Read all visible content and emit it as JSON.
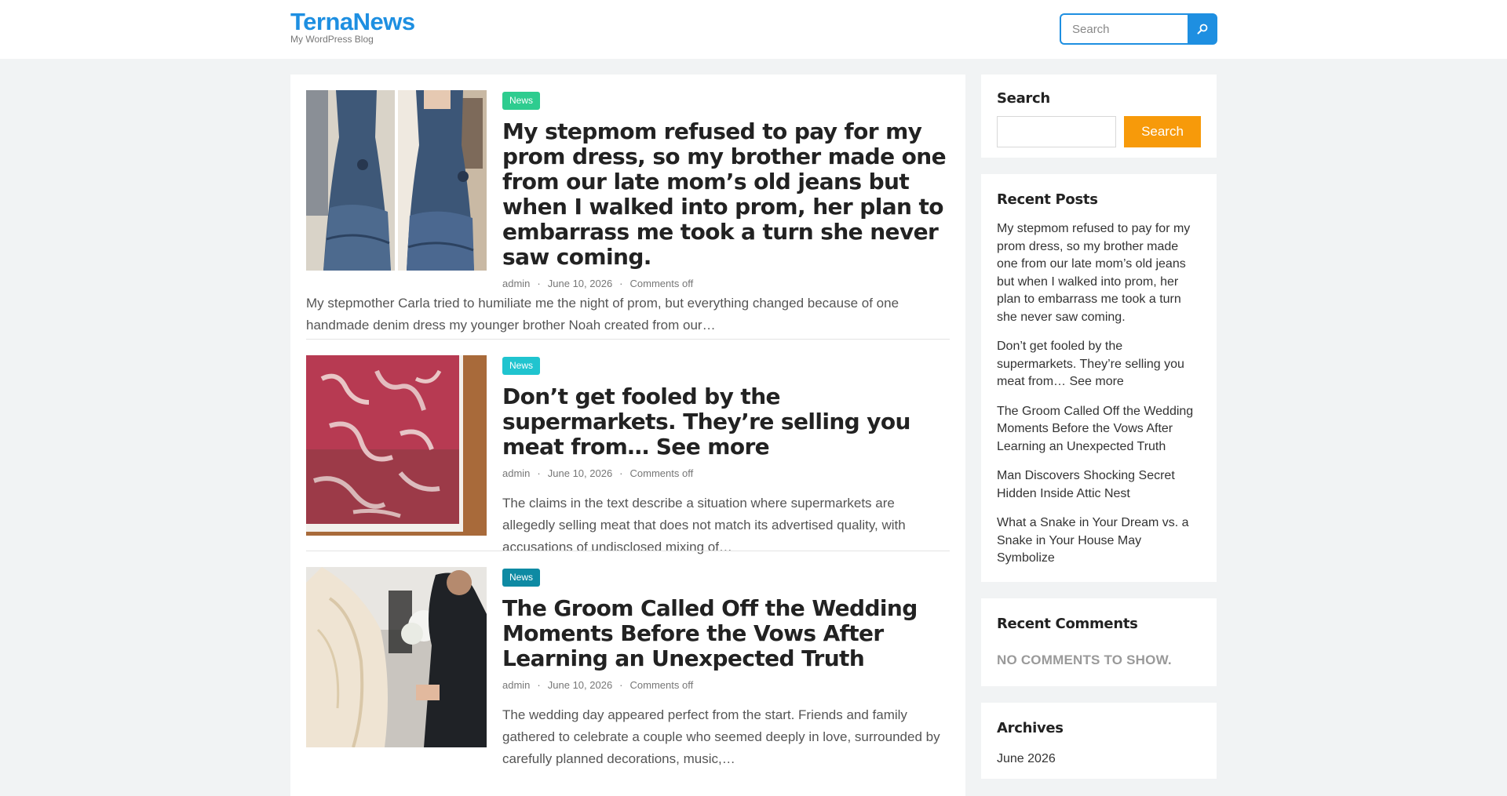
{
  "header": {
    "site_title": "TernaNews",
    "tagline": "My WordPress Blog",
    "search_placeholder": "Search"
  },
  "posts": [
    {
      "category": "News",
      "category_color": "#2ecc8f",
      "title": "My stepmom refused to pay for my prom dress, so my brother made one from our late mom’s old jeans but when I walked into prom, her plan to embarrass me took a turn she never saw coming.",
      "author": "admin",
      "date": "June 10, 2026",
      "comments": "Comments off",
      "excerpt": "My stepmother Carla tried to humiliate me the night of prom, but everything changed because of one handmade denim dress my younger brother Noah created from our…"
    },
    {
      "category": "News",
      "category_color": "#20c4cf",
      "title": "Don’t get fooled by the supermarkets. They’re selling you meat from… See more",
      "author": "admin",
      "date": "June 10, 2026",
      "comments": "Comments off",
      "excerpt": "The claims in the text describe a situation where supermarkets are allegedly selling meat that does not match its advertised quality, with accusations of undisclosed mixing of…"
    },
    {
      "category": "News",
      "category_color": "#0e8aa3",
      "title": "The Groom Called Off the Wedding Moments Before the Vows After Learning an Unexpected Truth",
      "author": "admin",
      "date": "June 10, 2026",
      "comments": "Comments off",
      "excerpt": "The wedding day appeared perfect from the start. Friends and family gathered to celebrate a couple who seemed deeply in love, surrounded by carefully planned decorations, music,…"
    }
  ],
  "sidebar": {
    "search": {
      "title": "Search",
      "button": "Search"
    },
    "recent_posts": {
      "title": "Recent Posts",
      "items": [
        "My stepmom refused to pay for my prom dress, so my brother made one from our late mom’s old jeans but when I walked into prom, her plan to embarrass me took a turn she never saw coming.",
        "Don’t get fooled by the supermarkets. They’re selling you meat from… See more",
        "The Groom Called Off the Wedding Moments Before the Vows After Learning an Unexpected Truth",
        "Man Discovers Shocking Secret Hidden Inside Attic Nest",
        "What a Snake in Your Dream vs. a Snake in Your House May Symbolize"
      ]
    },
    "recent_comments": {
      "title": "Recent Comments",
      "empty": "NO COMMENTS TO SHOW."
    },
    "archives": {
      "title": "Archives",
      "items": [
        "June 2026"
      ]
    }
  },
  "colors": {
    "brand": "#1e8fe1",
    "search_button": "#f79a0a"
  }
}
